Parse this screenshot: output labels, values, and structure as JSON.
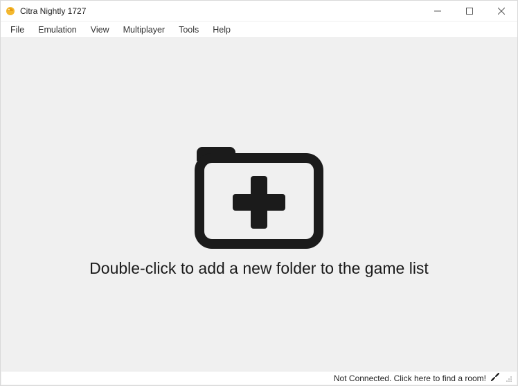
{
  "window": {
    "title": "Citra Nightly 1727"
  },
  "menu": {
    "items": [
      "File",
      "Emulation",
      "View",
      "Multiplayer",
      "Tools",
      "Help"
    ]
  },
  "main": {
    "prompt": "Double-click to add a new folder to the game list"
  },
  "status": {
    "text_not_connected": "Not Connected. Click here to find a room!"
  }
}
